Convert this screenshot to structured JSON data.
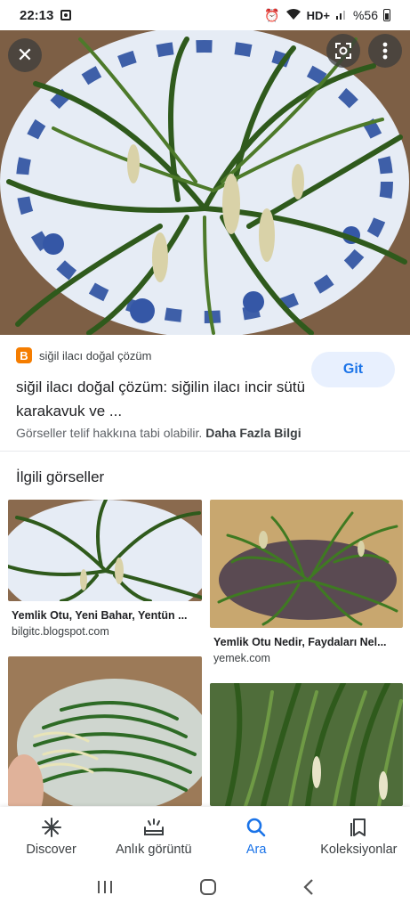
{
  "status_bar": {
    "time": "22:13",
    "network": "HD+",
    "battery": "%56"
  },
  "hero": {
    "close_icon": "close-icon",
    "lens_icon": "google-lens-icon",
    "more_icon": "more-vert-icon"
  },
  "result": {
    "source_icon": "B",
    "source": "siğil ilacı doğal çözüm",
    "title": "siğil ilacı doğal çözüm: siğilin ilacı incir sütü karakavuk ve ...",
    "visit_label": "Git",
    "copyright": "Görseller telif hakkına tabi olabilir.",
    "more_info": "Daha Fazla Bilgi"
  },
  "related": {
    "heading": "İlgili görseller",
    "items": [
      {
        "caption": "Yemlik Otu, Yeni Bahar, Yentün ...",
        "site": "bilgitc.blogspot.com"
      },
      {
        "caption": "Yemlik Otu Nedir, Faydaları Nel...",
        "site": "yemek.com"
      },
      {
        "caption": "",
        "site": ""
      },
      {
        "caption": "",
        "site": ""
      }
    ]
  },
  "bottom_nav": {
    "items": [
      {
        "label": "Discover",
        "icon": "discover-icon"
      },
      {
        "label": "Anlık görüntü",
        "icon": "snapshot-icon"
      },
      {
        "label": "Ara",
        "icon": "search-icon"
      },
      {
        "label": "Koleksiyonlar",
        "icon": "collections-icon"
      }
    ],
    "active": "Ara"
  },
  "colors": {
    "accent": "#1a73e8",
    "button_bg": "#e8f0fe",
    "blogger": "#f57d00"
  }
}
